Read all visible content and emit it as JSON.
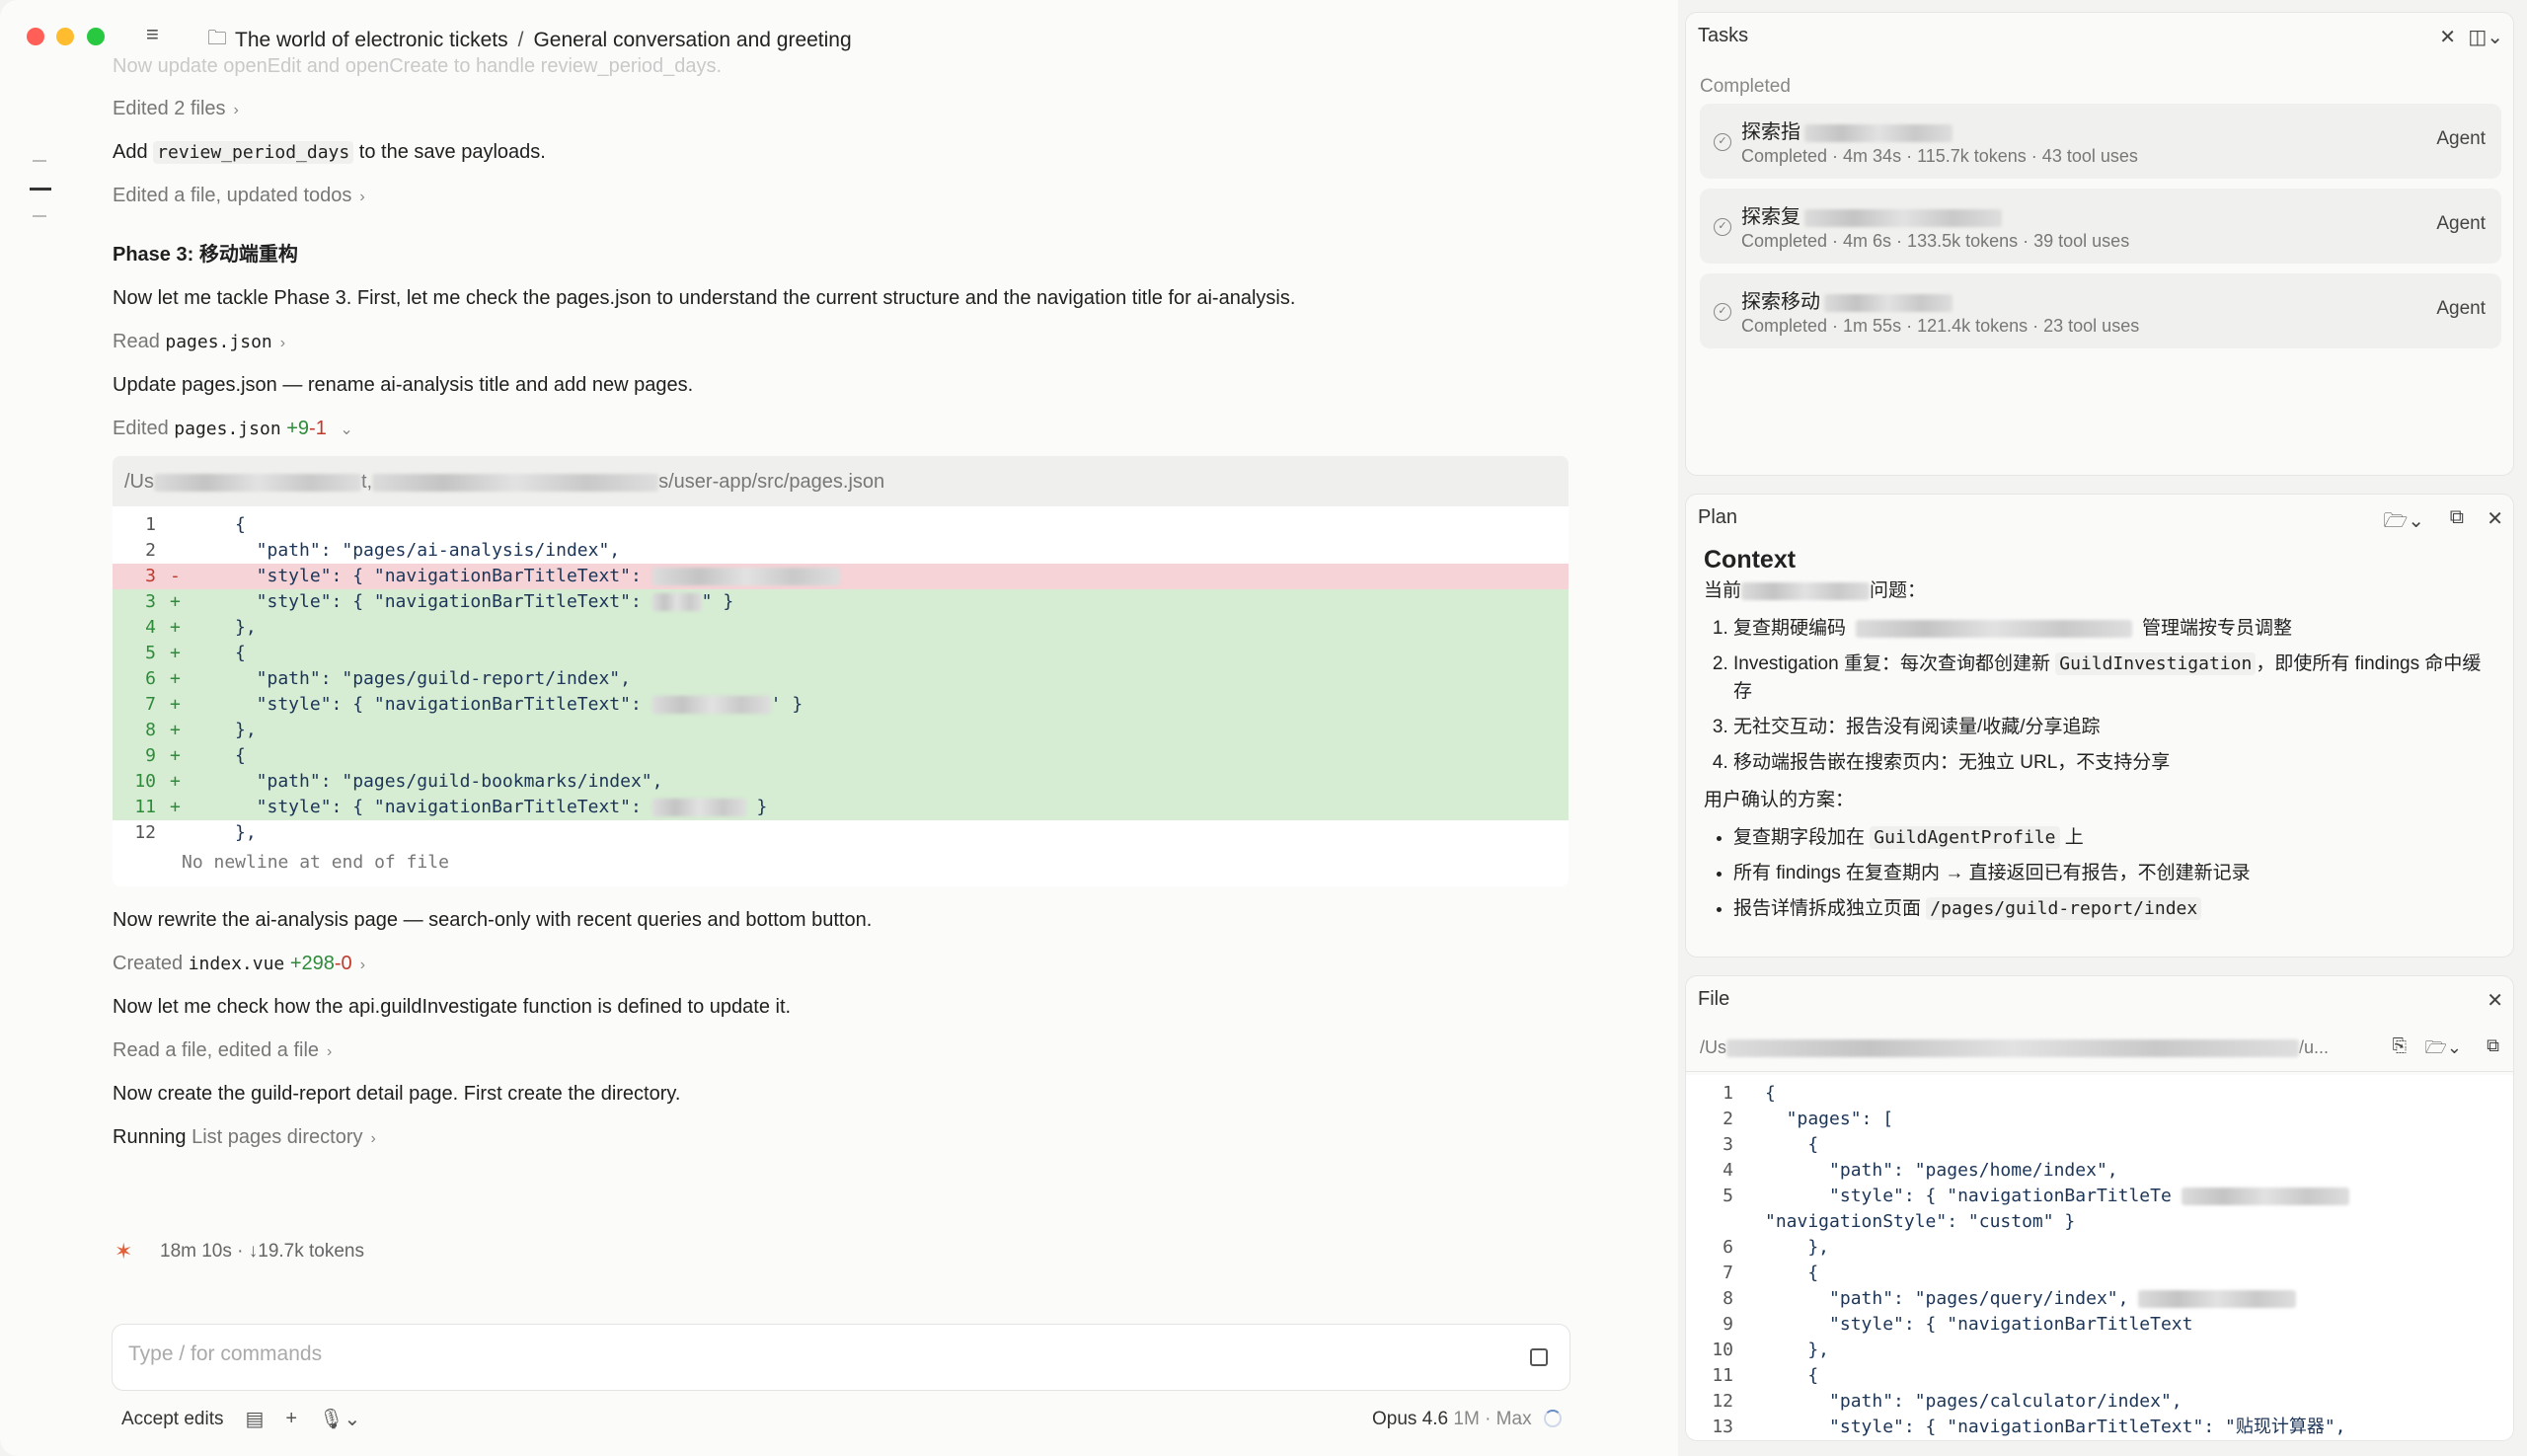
{
  "titlebar": {
    "breadcrumb_project": "The world of electronic tickets",
    "breadcrumb_separator": "/",
    "breadcrumb_chat": "General conversation and greeting"
  },
  "conversation": {
    "faded_line": "Now update openEdit and openCreate to handle review_period_days.",
    "edited_files": "Edited 2 files",
    "add_line_prefix": "Add",
    "add_line_code": "review_period_days",
    "add_line_suffix": "to the save payloads.",
    "edited_file_todos": "Edited a file, updated todos",
    "phase_heading": "Phase 3: 移动端重构",
    "phase_text": "Now let me tackle Phase 3. First, let me check the pages.json to understand the current structure and the navigation title for ai-analysis.",
    "read_label": "Read",
    "read_file": "pages.json",
    "update_text": "Update pages.json — rename ai-analysis title and add new pages.",
    "edited_label": "Edited",
    "edited_file": "pages.json",
    "edited_added": "+9",
    "edited_removed": "-1",
    "diff_path_start": "/Us",
    "diff_path_mid": "t,",
    "diff_path_end": "s/user-app/src/pages.json",
    "no_newline": "No newline at end of file",
    "rewrite_text": "Now rewrite the ai-analysis page — search-only with recent queries and bottom button.",
    "created_label": "Created",
    "created_file": "index.vue",
    "created_added": "+298",
    "created_removed": "-0",
    "check_text": "Now let me check how the api.guildInvestigate function is defined to update it.",
    "read_edited": "Read a file, edited a file",
    "create_detail_text": "Now create the guild-report detail page. First create the directory.",
    "running_label": "Running",
    "running_task": "List pages directory"
  },
  "diff_lines": [
    {
      "n": "1",
      "mark": "",
      "type": "ctx",
      "code": "{"
    },
    {
      "n": "2",
      "mark": "",
      "type": "ctx",
      "code": "  \"path\": \"pages/ai-analysis/index\","
    },
    {
      "n": "3",
      "mark": "-",
      "type": "del",
      "code": "  \"style\": { \"navigationBarTitleText\": "
    },
    {
      "n": "3",
      "mark": "+",
      "type": "add",
      "code": "  \"style\": { \"navigationBarTitleText\": ",
      "tail": "\" }"
    },
    {
      "n": "4",
      "mark": "+",
      "type": "add",
      "code": "},"
    },
    {
      "n": "5",
      "mark": "+",
      "type": "add",
      "code": "{"
    },
    {
      "n": "6",
      "mark": "+",
      "type": "add",
      "code": "  \"path\": \"pages/guild-report/index\","
    },
    {
      "n": "7",
      "mark": "+",
      "type": "add",
      "code": "  \"style\": { \"navigationBarTitleText\": ",
      "tail": "' }"
    },
    {
      "n": "8",
      "mark": "+",
      "type": "add",
      "code": "},"
    },
    {
      "n": "9",
      "mark": "+",
      "type": "add",
      "code": "{"
    },
    {
      "n": "10",
      "mark": "+",
      "type": "add",
      "code": "  \"path\": \"pages/guild-bookmarks/index\","
    },
    {
      "n": "11",
      "mark": "+",
      "type": "add",
      "code": "  \"style\": { \"navigationBarTitleText\": ",
      "tail": " }"
    },
    {
      "n": "12",
      "mark": "",
      "type": "ctx",
      "code": "},"
    }
  ],
  "status": {
    "elapsed": "18m 10s · ↓19.7k tokens"
  },
  "input": {
    "placeholder": "Type / for commands"
  },
  "bottombar": {
    "accept_edits": "Accept edits",
    "model_name": "Opus 4.6",
    "model_context": "1M · Max"
  },
  "tasks": {
    "title": "Tasks",
    "section": "Completed",
    "items": [
      {
        "name": "探索指",
        "meta": "Completed · 4m 34s · 115.7k tokens · 43 tool uses",
        "badge": "Agent"
      },
      {
        "name": "探索复",
        "meta": "Completed · 4m 6s · 133.5k tokens · 39 tool uses",
        "badge": "Agent"
      },
      {
        "name": "探索移动",
        "meta": "Completed · 1m 55s · 121.4k tokens · 23 tool uses",
        "badge": "Agent"
      }
    ]
  },
  "plan": {
    "title": "Plan",
    "heading": "Context",
    "intro_start": "当前",
    "intro_end": "问题：",
    "items": [
      {
        "start": "复查期硬编码",
        "end": "管理端按专员调整"
      },
      {
        "start": "Investigation 重复：每次查询都创建新 ",
        "code": "GuildInvestigation",
        "end": "，即使所有 findings 命中缓存"
      },
      {
        "start": "无社交互动：报告没有阅读量/收藏/分享追踪"
      },
      {
        "start": "移动端报告嵌在搜索页内：无独立 URL，不支持分享"
      }
    ],
    "confirmed": "用户确认的方案：",
    "bullets": [
      {
        "start": "复查期字段加在 ",
        "code": "GuildAgentProfile",
        "end": " 上"
      },
      {
        "start": "所有 findings 在复查期内 → 直接返回已有报告，不创建新记录"
      },
      {
        "start": "报告详情拆成独立页面 ",
        "code": "/pages/guild-report/index"
      }
    ]
  },
  "file": {
    "title": "File",
    "path_start": "/Us",
    "path_end": "/u...",
    "lines": [
      {
        "n": "1",
        "code": "{"
      },
      {
        "n": "2",
        "code": "  \"pages\": ["
      },
      {
        "n": "3",
        "code": "    {"
      },
      {
        "n": "4",
        "code": "      \"path\": \"pages/home/index\","
      },
      {
        "n": "5",
        "code": "      \"style\": { \"navigationBarTitleTe"
      },
      {
        "n": "",
        "code": "\"navigationStyle\": \"custom\" }"
      },
      {
        "n": "6",
        "code": "    },"
      },
      {
        "n": "7",
        "code": "    {"
      },
      {
        "n": "8",
        "code": "      \"path\": \"pages/query/index\","
      },
      {
        "n": "9",
        "code": "      \"style\": { \"navigationBarTitleText"
      },
      {
        "n": "10",
        "code": "    },"
      },
      {
        "n": "11",
        "code": "    {"
      },
      {
        "n": "12",
        "code": "      \"path\": \"pages/calculator/index\","
      },
      {
        "n": "13",
        "code": "      \"style\": { \"navigationBarTitleText\": \"贴现计算器\","
      }
    ]
  }
}
